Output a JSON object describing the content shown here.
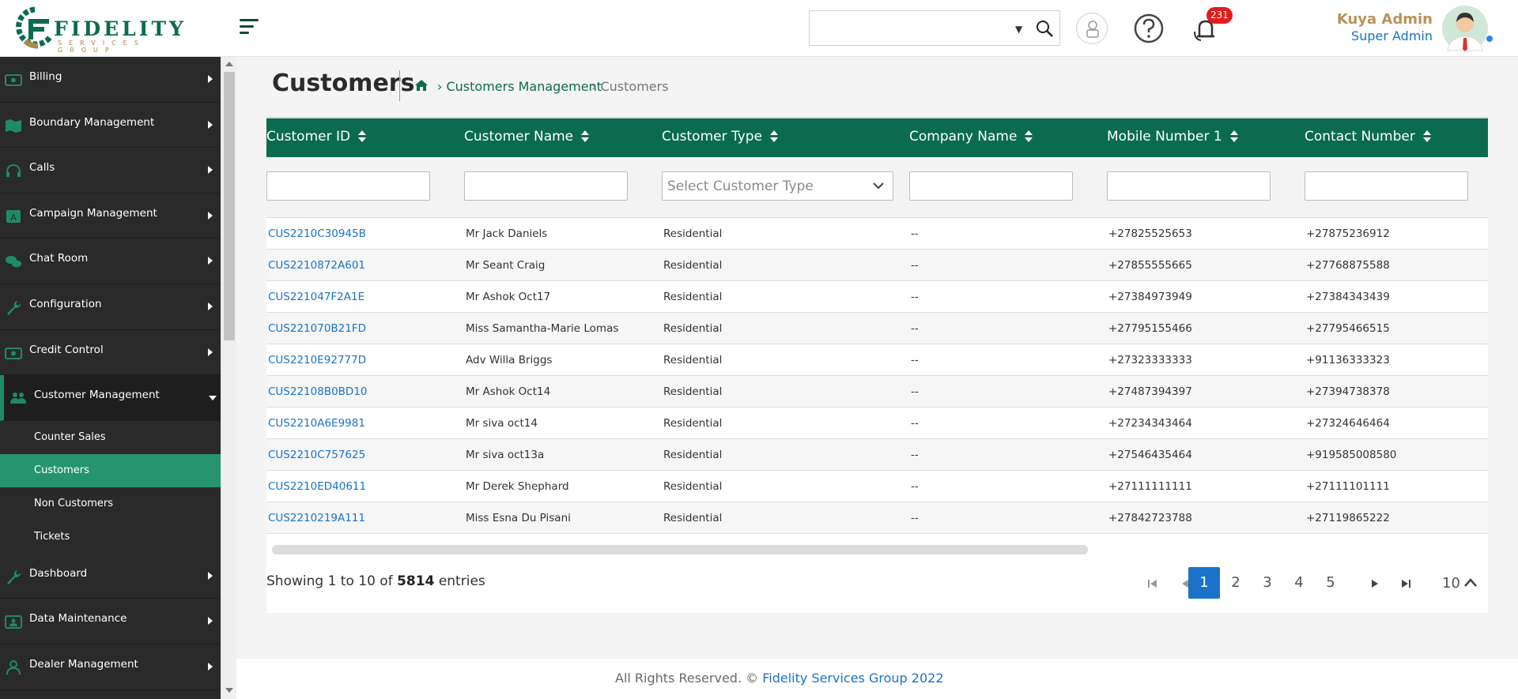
{
  "brand": {
    "name": "FIDELITY",
    "tagline": "SERVICES GROUP",
    "colors": {
      "primary": "#0b6b4f",
      "gold": "#b9925a",
      "link": "#1a73c8",
      "sidebar": "#2a2a2a",
      "active": "#26956f",
      "badge": "#e21b1b"
    }
  },
  "header": {
    "notification_count": "231",
    "icons": [
      "menu-icon",
      "search-icon",
      "user-lock-icon",
      "help-icon",
      "bell-icon"
    ],
    "user": {
      "name": "Kuya Admin",
      "role": "Super Admin"
    }
  },
  "sidebar": {
    "items_before": [
      {
        "label": "Billing",
        "icon": "money-icon"
      },
      {
        "label": "Boundary Management",
        "icon": "map-icon"
      },
      {
        "label": "Calls",
        "icon": "headset-icon"
      },
      {
        "label": "Campaign Management",
        "icon": "campaign-icon"
      },
      {
        "label": "Chat Room",
        "icon": "chat-icon"
      },
      {
        "label": "Configuration",
        "icon": "wrench-icon"
      },
      {
        "label": "Credit Control",
        "icon": "money-icon"
      }
    ],
    "open_item": {
      "label": "Customer Management",
      "icon": "users-icon"
    },
    "sub_items": [
      {
        "label": "Counter Sales",
        "active": false
      },
      {
        "label": "Customers",
        "active": true
      },
      {
        "label": "Non Customers",
        "active": false
      },
      {
        "label": "Tickets",
        "active": false
      }
    ],
    "items_after": [
      {
        "label": "Dashboard",
        "icon": "wrench-icon"
      },
      {
        "label": "Data Maintenance",
        "icon": "id-card-icon"
      },
      {
        "label": "Dealer Management",
        "icon": "user-icon"
      }
    ]
  },
  "page": {
    "title": "Customers",
    "breadcrumb": [
      "› Customers Management",
      "› Customers"
    ]
  },
  "table": {
    "columns": [
      "Customer ID",
      "Customer Name",
      "Customer Type",
      "Company Name",
      "Mobile Number 1",
      "Contact Number"
    ],
    "filter_placeholder_type": "Select Customer Type",
    "rows": [
      [
        "CUS2210C30945B",
        "Mr Jack Daniels",
        "Residential",
        "--",
        "+27825525653",
        "+27875236912"
      ],
      [
        "CUS2210872A601",
        "Mr Seant Craig",
        "Residential",
        "--",
        "+27855555665",
        "+27768875588"
      ],
      [
        "CUS221047F2A1E",
        "Mr Ashok Oct17",
        "Residential",
        "--",
        "+27384973949",
        "+27384343439"
      ],
      [
        "CUS221070B21FD",
        "Miss Samantha-Marie Lomas",
        "Residential",
        "--",
        "+27795155466",
        "+27795466515"
      ],
      [
        "CUS2210E92777D",
        "Adv Willa Briggs",
        "Residential",
        "--",
        "+27323333333",
        "+91136333323"
      ],
      [
        "CUS22108B0BD10",
        "Mr Ashok Oct14",
        "Residential",
        "--",
        "+27487394397",
        "+27394738378"
      ],
      [
        "CUS2210A6E9981",
        "Mr siva oct14",
        "Residential",
        "--",
        "+27234343464",
        "+27324646464"
      ],
      [
        "CUS2210C757625",
        "Mr siva oct13a",
        "Residential",
        "--",
        "+27546435464",
        "+919585008580"
      ],
      [
        "CUS2210ED40611",
        "Mr Derek Shephard",
        "Residential",
        "--",
        "+27111111111",
        "+27111101111"
      ],
      [
        "CUS2210219A111",
        "Miss Esna Du Pisani",
        "Residential",
        "--",
        "+27842723788",
        "+27119865222"
      ]
    ]
  },
  "pagination": {
    "showing_prefix": "Showing 1 to 10 of",
    "total": "5814",
    "showing_suffix": "entries",
    "pages": [
      "1",
      "2",
      "3",
      "4",
      "5"
    ],
    "current_page": "1",
    "page_size": "10"
  },
  "footer": {
    "text": "All Rights Reserved. ©",
    "link": "Fidelity Services Group 2022"
  }
}
